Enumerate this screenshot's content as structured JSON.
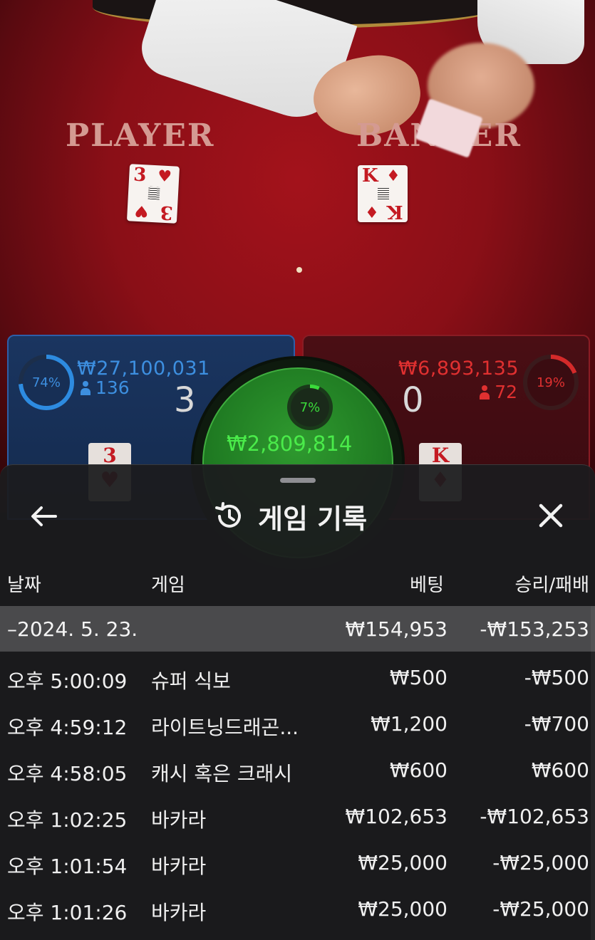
{
  "table": {
    "player_label": "PLAYER",
    "banker_label": "BANKER",
    "player_card": {
      "rank": "3",
      "suit": "♥"
    },
    "banker_card": {
      "rank": "K",
      "suit": "♦"
    }
  },
  "bets": {
    "player": {
      "percent": "74%",
      "amount": "₩27,100,031",
      "people": "136",
      "score": "3",
      "card_rank": "3",
      "card_suit": "♥"
    },
    "banker": {
      "percent": "19%",
      "amount": "₩6,893,135",
      "people": "72",
      "score": "0",
      "card_rank": "K",
      "card_suit": "♦"
    },
    "tie": {
      "percent": "7%",
      "amount": "₩2,809,814"
    }
  },
  "history": {
    "title": "게임 기록",
    "columns": {
      "date": "날짜",
      "game": "게임",
      "bet": "베팅",
      "win_loss": "승리/패배"
    },
    "date_group": {
      "date": "–2024. 5. 23.",
      "bet": "₩154,953",
      "win_loss": "-₩153,253"
    },
    "rows": [
      {
        "time": "오후 5:00:09",
        "game": "슈퍼 식보",
        "bet": "₩500",
        "win_loss": "-₩500"
      },
      {
        "time": "오후 4:59:12",
        "game": "라이트닝드래곤...",
        "bet": "₩1,200",
        "win_loss": "-₩700"
      },
      {
        "time": "오후 4:58:05",
        "game": "캐시 혹은 크래시",
        "bet": "₩600",
        "win_loss": "₩600"
      },
      {
        "time": "오후 1:02:25",
        "game": "바카라",
        "bet": "₩102,653",
        "win_loss": "-₩102,653"
      },
      {
        "time": "오후 1:01:54",
        "game": "바카라",
        "bet": "₩25,000",
        "win_loss": "-₩25,000"
      },
      {
        "time": "오후 1:01:26",
        "game": "바카라",
        "bet": "₩25,000",
        "win_loss": "-₩25,000"
      }
    ]
  },
  "icons": {
    "back": "arrow-left-icon",
    "history": "history-clock-icon",
    "close": "close-icon",
    "person": "person-icon"
  },
  "colors": {
    "player": "#3d8fe0",
    "banker": "#e03030",
    "tie": "#4aeb4a",
    "sheet_bg": "#1c1c1e",
    "date_row_bg": "#4a4a4c"
  }
}
